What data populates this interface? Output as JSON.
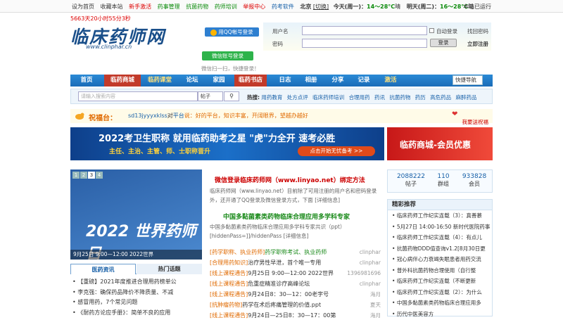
{
  "topbar": {
    "left_links": [
      "设为首页",
      "收藏本站",
      "新手激活",
      "药事管理",
      "抗菌药物",
      "药师培训",
      "举报中心",
      "药考软件"
    ],
    "city": "北京",
    "switch": "[切换]",
    "today_label": "今天(周一)：",
    "today_temp": "14～28°C",
    "today_weather": "晴",
    "tomorrow_label": "明天(周二)：",
    "tomorrow_temp": "16～28°C",
    "tomorrow_weather": "晴",
    "right_text": "本站已运行"
  },
  "uptime": "5663天20小时55分3秒",
  "logo": {
    "main": "临床药师网",
    "sub": "www.clinphar.cn"
  },
  "qq_login": "用QQ帐号登录",
  "wechat_login": "微信账号登录",
  "wechat_tip": "微信扫一扫，快捷登录！",
  "login": {
    "user_label": "用户名",
    "pass_label": "密码",
    "auto_login": "自动登录",
    "find_pass": "找回密码",
    "login_btn": "登录",
    "register": "立即注册"
  },
  "nav": {
    "items": [
      "首页",
      "临药商城",
      "临药课堂",
      "论坛",
      "家园",
      "临药书店",
      "日志",
      "相册",
      "分享",
      "记录",
      "激活"
    ],
    "quick": "快捷导航"
  },
  "search": {
    "placeholder": "请输入搜索内容",
    "select": "帖子",
    "hot_label": "热搜:",
    "hot_items": [
      "用药教育",
      "处方点评",
      "临床药师培训",
      "合理用药",
      "药讯",
      "抗菌药物",
      "药历",
      "高危药品",
      "麻醉药品"
    ]
  },
  "bless": {
    "title": "祝福台：",
    "user": "sd13jyyyxklss",
    "mid": "对",
    "target": "平台",
    "text": "说：好的平台，知识丰富，开阔眼界，望越办越好",
    "send": "我要送祝福"
  },
  "banner1": {
    "line1": "2022考卫生职称  就用临药助考之星  \"虎\"力全开  速考必胜",
    "line2": "主任、主治、主管、师、士职称晋升",
    "btn": "点击开始无忧备考 >>"
  },
  "banner2": {
    "text": "临药商城-会员优惠"
  },
  "slide": {
    "nums": [
      "1",
      "2",
      "3",
      "4"
    ],
    "big": "2022 世界药师日",
    "caption": "9月25日 9:00—12:00 2022世界"
  },
  "tabs": [
    "医药资讯",
    "热门话题"
  ],
  "left_list": [
    "【重磅】2021年度推进合理用药榜单公",
    "李克强：确保药品降价不降质量、不减",
    "感冒用药，7个常见问题",
    "《耐药方论应手册》：简单不良的应用"
  ],
  "mid": {
    "h1": "微信登录临床药师网（www.linyao.net）绑定方法",
    "p1": "临床药师网（www.linyao.net）目前除了可用注册的用户名和密码登录",
    "p2": "外，还开通了QQ登录及微信登录方式，下面 [详细信息]",
    "h2": "中国多黏菌素类药物临床合理应用多学科专家",
    "p3": "中国多黏菌素类药物临床合理应用多学科专家共识（ppt）",
    "p4": "[hiddenPass=]]/hiddenPass [详细信息]",
    "rows": [
      {
        "cat": "[药学职称、执业药师]",
        "title": "药学职称考试、执业药师",
        "author": "clinphar"
      },
      {
        "cat": "[合理用药知识]",
        "title": "治疗男性早泄，首个唯一专用",
        "author": "clinphar"
      },
      {
        "cat": "[线上课程通告]",
        "title": "9月25日 9:00—12:00 2022世界",
        "author": "1396981696"
      },
      {
        "cat": "[线上课程通告]",
        "title": "危重症精准诊疗高峰论坛",
        "author": "clinphar"
      },
      {
        "cat": "[线上课程通告]",
        "title": "9月24日8：30—12：00老字号",
        "author": "海月"
      },
      {
        "cat": "[抗肿瘤药物]",
        "title": "药学在术后疼痛管理的价值.ppt",
        "author": "夏天"
      },
      {
        "cat": "[线上课程通告]",
        "title": "9月24日—25日8：30—17：00第",
        "author": "海月"
      }
    ]
  },
  "stats": [
    {
      "value": "2088222",
      "label": "帖子"
    },
    {
      "value": "110",
      "label": "群组"
    },
    {
      "value": "933828",
      "label": "会员"
    }
  ],
  "rec": {
    "title": "精彩推荐",
    "items": [
      "临床药师工作纪实连载（3）：真善慕",
      "5月27日 14:00-16:50 新时代医院药事",
      "临床药师工作纪实连载（4）：有点儿",
      "抗菌药物DDD值查询v1.2[8月30日更",
      "冠心病伴心力衰竭失眠患者用药交流",
      "普外科抗菌药物合理使用（自行整",
      "临床药师工作纪实连载（不断更新",
      "临床药师工作纪实连载（2）：为什么",
      "中国多黏菌素类药物临床合理应用多",
      "历代中医美容方"
    ]
  }
}
